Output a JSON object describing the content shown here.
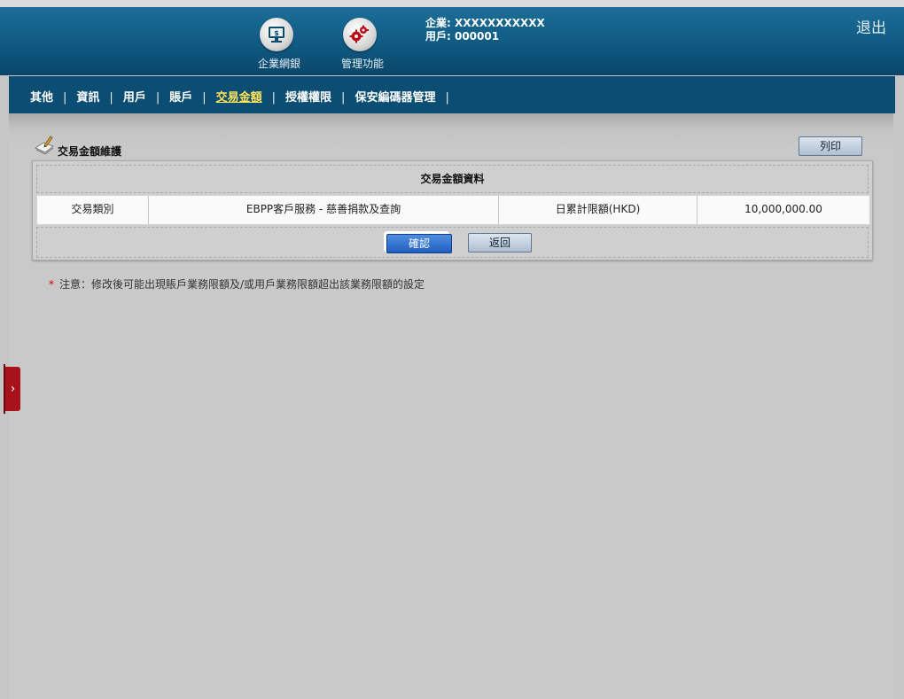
{
  "header": {
    "nav": [
      {
        "label": "企業網銀",
        "icon": "online-banking-icon"
      },
      {
        "label": "管理功能",
        "icon": "management-gears-icon"
      }
    ],
    "company_label": "企業: XXXXXXXXXXX",
    "user_label": "用戶: 000001",
    "logout": "退出"
  },
  "menu": {
    "items": [
      "其他",
      "資訊",
      "用戶",
      "賬戶",
      "交易金額",
      "授權權限",
      "保安編碼器管理"
    ],
    "active": "交易金額",
    "separator": "|"
  },
  "page": {
    "title": "交易金額維護",
    "title_icon": "edit-document-icon",
    "print_button": "列印"
  },
  "panel": {
    "heading": "交易金額資料",
    "row": {
      "type_label": "交易類別",
      "type_value": "EBPP客戶服務 - 慈善捐款及查詢",
      "limit_label": "日累計限額(HKD)",
      "limit_value": "10,000,000.00"
    },
    "confirm_button": "確認",
    "back_button": "返回"
  },
  "note": {
    "marker": "*",
    "text": "注意：修改後可能出現賬戶業務限額及/或用戶業務限額超出該業務限額的設定"
  },
  "side_tab": {
    "icon": "chevron-right-icon",
    "glyph": "›"
  },
  "colors": {
    "header_blue": "#0f5a83",
    "menu_blue": "#0b4d73",
    "active_menu": "#ffe35a",
    "confirm_blue": "#1f5fc0",
    "side_tab_red": "#a8121b",
    "note_star": "#c40000"
  }
}
